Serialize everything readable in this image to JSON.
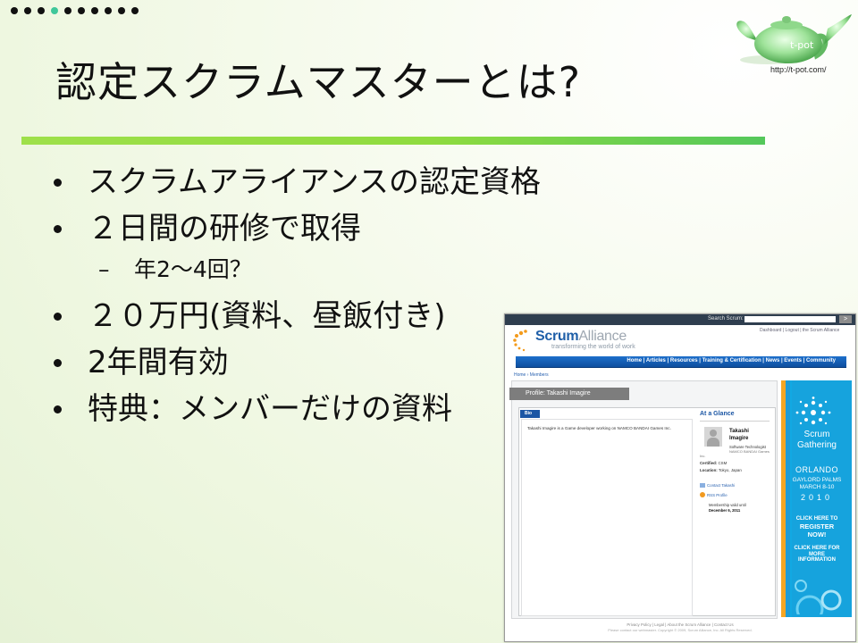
{
  "header": {
    "logo_text": "t-pot",
    "logo_url": "http://t-pot.com/"
  },
  "slide": {
    "title": "認定スクラムマスターとは?",
    "bullets": [
      "スクラムアライアンスの認定資格",
      "２日間の研修で取得",
      "２０万円(資料、昼飯付き)",
      "2年間有効",
      "特典：メンバーだけの資料"
    ],
    "sub_bullet": "年2～4回？"
  },
  "screenshot": {
    "search_label": "Search Scrum:",
    "search_button": ">",
    "account_links": "Dashboard | Logout | the Scrum Alliance",
    "brand_scrum": "Scrum",
    "brand_alliance": "Alliance",
    "tagline": "transforming the world of work",
    "nav": "Home | Articles | Resources | Training & Certification | News | Events | Community",
    "breadcrumb": "Home › Members",
    "profile_heading": "Profile: Takashi Imagire",
    "bio_tab": "Bio",
    "bio_text": "Takashi Imagire is a Game developer working on NAMCO BANDAI Games Inc.",
    "glance_title": "At a Glance",
    "first_name": "Takashi",
    "last_name": "Imagire",
    "role": "Software Technologist",
    "company": "NAMCO BANDAI Games",
    "extra": "Inc.",
    "certified_label": "Certified:",
    "certified_value": "CSM",
    "location_label": "Location:",
    "location_value": "Tokyo, Japan",
    "contact": "Contact Takashi",
    "rss": "RSS Profile",
    "membership_label": "Membership valid until",
    "membership_date": "December 6, 2011",
    "ad": {
      "title1": "Scrum",
      "title2": "Gathering",
      "city": "ORLANDO",
      "venue": "GAYLORD PALMS",
      "dates": "MARCH 8-10",
      "year": "2010",
      "register1": "CLICK HERE TO",
      "register2": "REGISTER NOW!",
      "more1": "CLICK HERE FOR",
      "more2": "MORE INFORMATION"
    },
    "footer1": "Privacy Policy | Legal | About the Scrum Alliance | Contact Us",
    "footer2": "Please contact our webmaster. Copyright © 2009, Scrum Alliance, Inc. All Rights Reserved."
  },
  "colors": {
    "title_rule": "#8fdb3f",
    "active_dot": "#3fc79a",
    "site_nav": "#1d6fcb",
    "ad_blue": "#16a3dd"
  }
}
